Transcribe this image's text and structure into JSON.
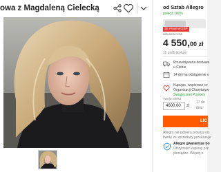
{
  "header": {
    "title": "owa z Magdaleną Cielecką",
    "icons": [
      "share-icon",
      "heart-icon",
      "chevron-down-icon"
    ]
  },
  "seller": {
    "name": "od Sztab Allegro",
    "rating": "poleca 100%"
  },
  "auction": {
    "badge": "3E Final WOŚP",
    "badge_sub": "aktualna cena",
    "price": "4 550,",
    "price_suffix": "00 zł",
    "sold": "11 osób licytuje"
  },
  "delivery": [
    {
      "icon": "truck-icon",
      "line1": "Przewidywana dostawa",
      "line2": "u Ciebie"
    },
    {
      "icon": "return-icon",
      "line1": "14 dni na odstąpienie o"
    }
  ],
  "charity": {
    "icon": "charity-icon",
    "lines": [
      "Kupując, wspierasz ce",
      "Organizacji Charytatyw",
      "Świątecznej Pomocy"
    ]
  },
  "offer": {
    "label": "Twoja oferta",
    "value": "4600,00",
    "unit": "zł",
    "aside": [
      "17 do",
      "dnia"
    ],
    "button": "LIC"
  },
  "footer": {
    "lines": [
      "Allegro nie pobiera prowizji od",
      "kwotę ze sprzedaży przekazuje"
    ]
  },
  "guarantee": {
    "icon": "shield-icon",
    "title": "Allegro gwarantuje bo",
    "lines": [
      "Otrzymasz kupiony prz",
      "pieniądze. Więcej o"
    ]
  },
  "colors": {
    "accent": "#ff5a00",
    "success": "#27a42e",
    "badge": "#e53935"
  }
}
